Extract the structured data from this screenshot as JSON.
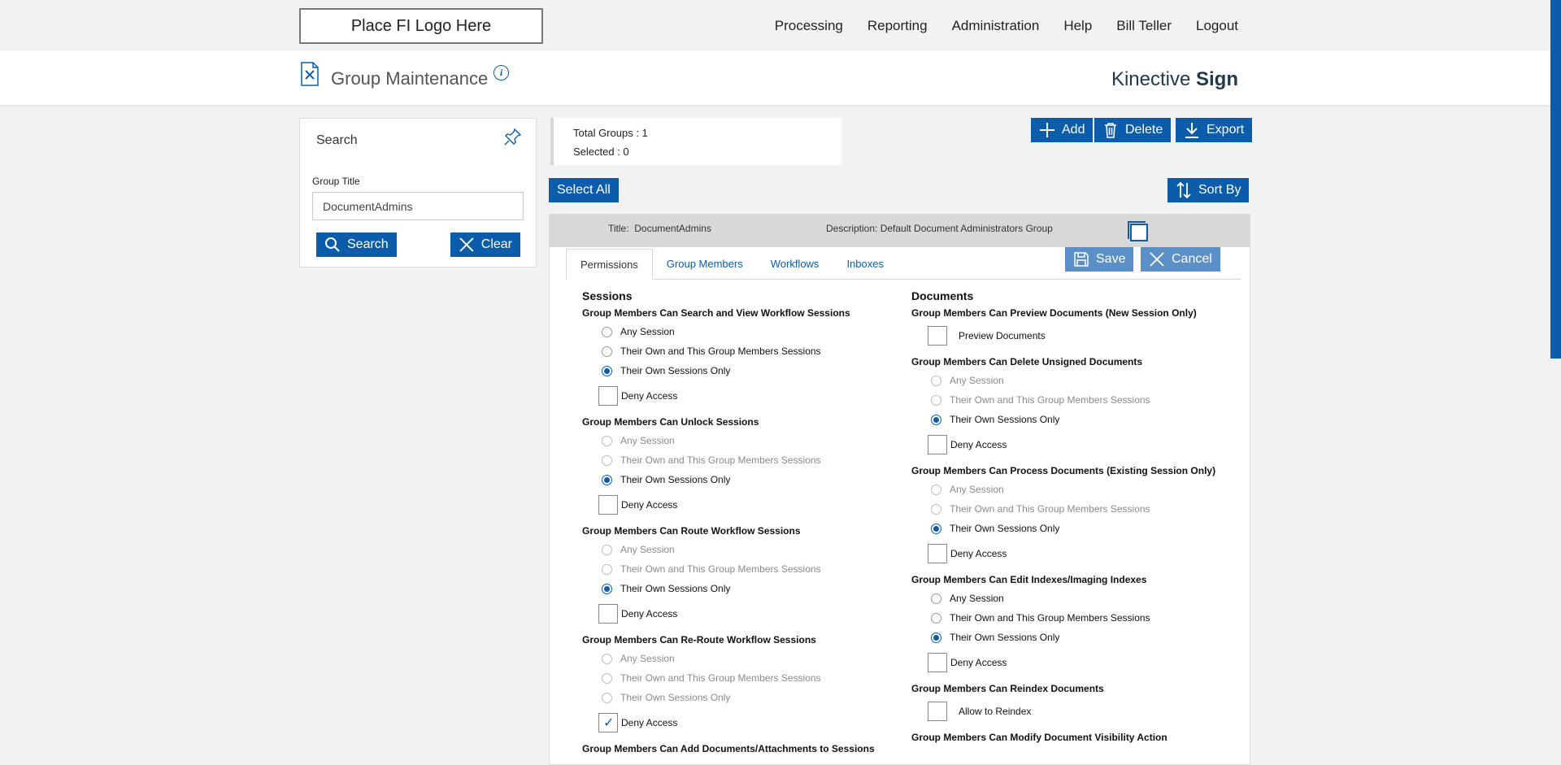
{
  "header": {
    "logo_text": "Place FI Logo Here",
    "nav": [
      "Processing",
      "Reporting",
      "Administration",
      "Help",
      "Bill Teller",
      "Logout"
    ]
  },
  "titlebar": {
    "title": "Group Maintenance",
    "info_glyph": "i",
    "brand_light": "Kinective",
    "brand_bold": "Sign"
  },
  "search": {
    "title": "Search",
    "field_label": "Group Title",
    "field_value": "DocumentAdmins",
    "search_button": "Search",
    "clear_button": "Clear"
  },
  "counts": {
    "total": "Total Groups : 1",
    "selected": "Selected : 0"
  },
  "toolbar": {
    "add": "Add",
    "delete": "Delete",
    "export": "Export",
    "select_all": "Select All",
    "sort_by": "Sort By"
  },
  "group": {
    "title_label": "Title:",
    "title_value": "DocumentAdmins",
    "description_label": "Description:",
    "description_value": "Default Document Administrators Group",
    "tabs": [
      "Permissions",
      "Group Members",
      "Workflows",
      "Inboxes"
    ],
    "save": "Save",
    "cancel": "Cancel"
  },
  "permissions": {
    "left_heading": "Sessions",
    "right_heading": "Documents",
    "any_session": "Any Session",
    "own_and_group": "Their Own and This Group Members Sessions",
    "own_only": "Their Own Sessions Only",
    "deny_access": "Deny Access",
    "left": {
      "q1": "Group Members Can Search and View Workflow Sessions",
      "q2": "Group Members Can Unlock Sessions",
      "q3": "Group Members Can Route Workflow Sessions",
      "q4": "Group Members Can Re-Route Workflow Sessions",
      "q5": "Group Members Can Add Documents/Attachments to Sessions"
    },
    "right": {
      "q1": "Group Members Can Preview Documents (New Session Only)",
      "preview_label": "Preview Documents",
      "q2": "Group Members Can Delete Unsigned Documents",
      "q3": "Group Members Can Process Documents (Existing Session Only)",
      "q4": "Group Members Can Edit Indexes/Imaging Indexes",
      "q5": "Group Members Can Reindex Documents",
      "reindex_label": "Allow to Reindex",
      "q6": "Group Members Can Modify Document Visibility Action"
    }
  },
  "colors": {
    "accent": "#0b5cab",
    "accent_light": "#5b8fc7",
    "background": "#f2f2f2"
  },
  "icons": [
    "document-settings-icon",
    "info-icon",
    "pin-icon",
    "search-icon",
    "close-icon",
    "plus-icon",
    "trash-icon",
    "download-icon",
    "sort-icon",
    "save-icon"
  ]
}
